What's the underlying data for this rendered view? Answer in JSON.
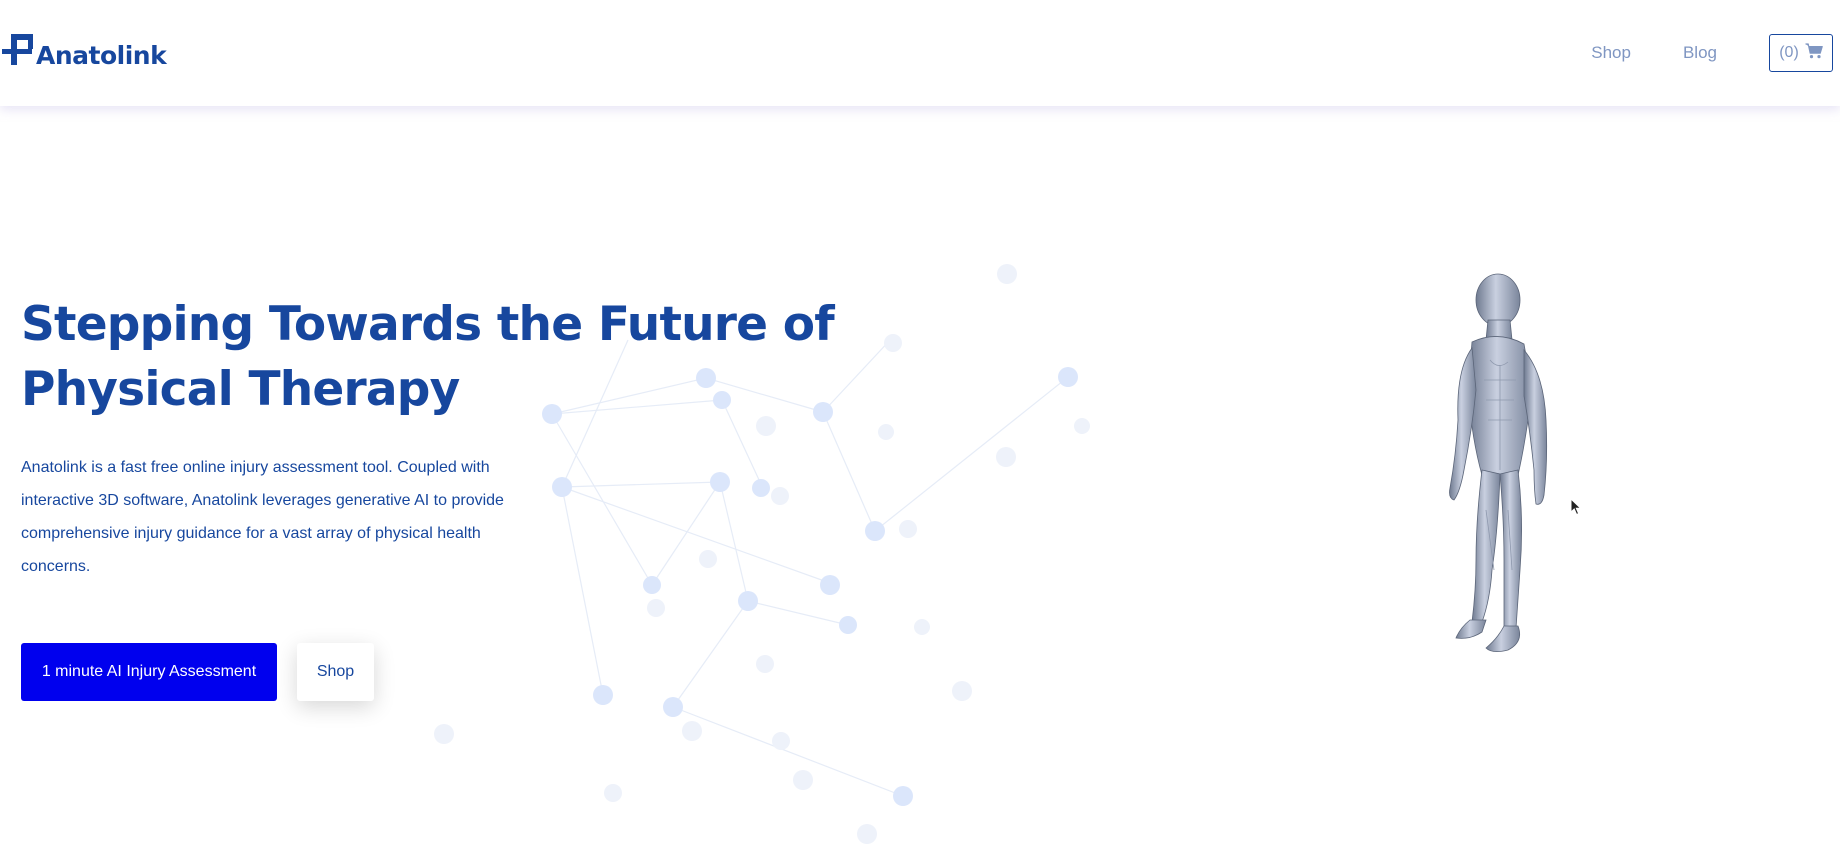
{
  "header": {
    "logo_text": "Anatolink",
    "nav": {
      "shop_label": "Shop",
      "blog_label": "Blog"
    },
    "cart": {
      "count_label": "(0)",
      "icon": "shopping-cart-icon"
    }
  },
  "hero": {
    "title": "Stepping Towards the Future of Physical Therapy",
    "description": "Anatolink is a fast free online injury assessment tool. Coupled with interactive 3D software, Anatolink leverages generative AI to provide comprehensive injury guidance for a vast array of physical health concerns.",
    "primary_cta": "1 minute AI Injury Assessment",
    "secondary_cta": "Shop"
  },
  "colors": {
    "brand": "#17479e",
    "nav_text": "#7f96c2",
    "primary_button": "#0000ee",
    "network_node": "#dbe6fb"
  }
}
